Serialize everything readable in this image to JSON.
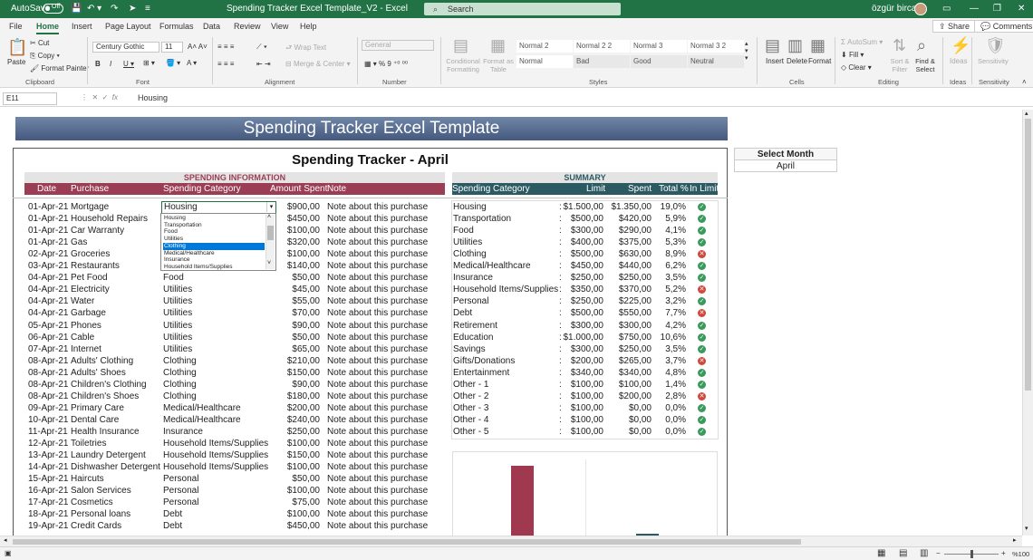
{
  "titlebar": {
    "autosave": "AutoSave",
    "autosave_state": "Off",
    "doc_title": "Spending Tracker Excel Template_V2  -  Excel",
    "search": "Search",
    "user": "özgür bircan"
  },
  "menu": {
    "tabs": [
      "File",
      "Home",
      "Insert",
      "Page Layout",
      "Formulas",
      "Data",
      "Review",
      "View",
      "Help"
    ],
    "share": "Share",
    "comments": "Comments"
  },
  "ribbon": {
    "clipboard": {
      "paste": "Paste",
      "cut": "Cut",
      "copy": "Copy",
      "format_painter": "Format Painter",
      "label": "Clipboard"
    },
    "font": {
      "name": "Century Gothic",
      "size": "11",
      "label": "Font"
    },
    "alignment": {
      "wrap": "Wrap Text",
      "merge": "Merge & Center",
      "label": "Alignment"
    },
    "number": {
      "format": "General",
      "label": "Number"
    },
    "styles": {
      "conditional": "Conditional Formatting",
      "format_table": "Format as Table",
      "cells": [
        "Normal 2",
        "Normal 2 2",
        "Normal 3",
        "Normal 3 2",
        "Normal",
        "Bad",
        "Good",
        "Neutral"
      ],
      "label": "Styles"
    },
    "cells": {
      "insert": "Insert",
      "delete": "Delete",
      "format": "Format",
      "label": "Cells"
    },
    "editing": {
      "autosum": "AutoSum",
      "fill": "Fill",
      "clear": "Clear",
      "sort": "Sort & Filter",
      "find": "Find & Select",
      "label": "Editing"
    },
    "ideas": {
      "label": "Ideas"
    },
    "sensitivity": {
      "label": "Sensitivity"
    }
  },
  "formula": {
    "cell_ref": "E11",
    "value": "Housing"
  },
  "sheet": {
    "banner": "Spending Tracker Excel Template",
    "title": "Spending Tracker - April",
    "spending_info": "SPENDING INFORMATION",
    "summary": "SUMMARY",
    "select_month_label": "Select Month",
    "select_month_value": "April",
    "headers": {
      "date": "Date",
      "purchase": "Purchase",
      "category": "Spending Category",
      "amount": "Amount Spent",
      "note": "Note"
    },
    "summary_headers": {
      "category": "Spending Category",
      "limit": "Limit",
      "spent": "Spent",
      "pct": "Total %",
      "inlimit": "In Limit"
    },
    "rows": [
      {
        "date": "01-Apr-21",
        "purchase": "Mortgage",
        "category": "Housing",
        "amount": "$900,00",
        "note": "Note about this purchase"
      },
      {
        "date": "01-Apr-21",
        "purchase": "Household Repairs",
        "category": "",
        "amount": "$450,00",
        "note": "Note about this purchase"
      },
      {
        "date": "01-Apr-21",
        "purchase": "Car Warranty",
        "category": "",
        "amount": "$100,00",
        "note": "Note about this purchase"
      },
      {
        "date": "01-Apr-21",
        "purchase": "Gas",
        "category": "",
        "amount": "$320,00",
        "note": "Note about this purchase"
      },
      {
        "date": "02-Apr-21",
        "purchase": "Groceries",
        "category": "",
        "amount": "$100,00",
        "note": "Note about this purchase"
      },
      {
        "date": "03-Apr-21",
        "purchase": "Restaurants",
        "category": "",
        "amount": "$140,00",
        "note": "Note about this purchase"
      },
      {
        "date": "04-Apr-21",
        "purchase": "Pet Food",
        "category": "Food",
        "amount": "$50,00",
        "note": "Note about this purchase"
      },
      {
        "date": "04-Apr-21",
        "purchase": "Electricity",
        "category": "Utilities",
        "amount": "$45,00",
        "note": "Note about this purchase"
      },
      {
        "date": "04-Apr-21",
        "purchase": "Water",
        "category": "Utilities",
        "amount": "$55,00",
        "note": "Note about this purchase"
      },
      {
        "date": "04-Apr-21",
        "purchase": "Garbage",
        "category": "Utilities",
        "amount": "$70,00",
        "note": "Note about this purchase"
      },
      {
        "date": "05-Apr-21",
        "purchase": "Phones",
        "category": "Utilities",
        "amount": "$90,00",
        "note": "Note about this purchase"
      },
      {
        "date": "06-Apr-21",
        "purchase": "Cable",
        "category": "Utilities",
        "amount": "$50,00",
        "note": "Note about this purchase"
      },
      {
        "date": "07-Apr-21",
        "purchase": "Internet",
        "category": "Utilities",
        "amount": "$65,00",
        "note": "Note about this purchase"
      },
      {
        "date": "08-Apr-21",
        "purchase": "Adults' Clothing",
        "category": "Clothing",
        "amount": "$210,00",
        "note": "Note about this purchase"
      },
      {
        "date": "08-Apr-21",
        "purchase": "Adults' Shoes",
        "category": "Clothing",
        "amount": "$150,00",
        "note": "Note about this purchase"
      },
      {
        "date": "08-Apr-21",
        "purchase": "Children's Clothing",
        "category": "Clothing",
        "amount": "$90,00",
        "note": "Note about this purchase"
      },
      {
        "date": "08-Apr-21",
        "purchase": "Children's Shoes",
        "category": "Clothing",
        "amount": "$180,00",
        "note": "Note about this purchase"
      },
      {
        "date": "09-Apr-21",
        "purchase": "Primary Care",
        "category": "Medical/Healthcare",
        "amount": "$200,00",
        "note": "Note about this purchase"
      },
      {
        "date": "10-Apr-21",
        "purchase": "Dental Care",
        "category": "Medical/Healthcare",
        "amount": "$240,00",
        "note": "Note about this purchase"
      },
      {
        "date": "11-Apr-21",
        "purchase": "Health Insurance",
        "category": "Insurance",
        "amount": "$250,00",
        "note": "Note about this purchase"
      },
      {
        "date": "12-Apr-21",
        "purchase": "Toiletries",
        "category": "Household Items/Supplies",
        "amount": "$100,00",
        "note": "Note about this purchase"
      },
      {
        "date": "13-Apr-21",
        "purchase": "Laundry Detergent",
        "category": "Household Items/Supplies",
        "amount": "$150,00",
        "note": "Note about this purchase"
      },
      {
        "date": "14-Apr-21",
        "purchase": "Dishwasher Detergent",
        "category": "Household Items/Supplies",
        "amount": "$100,00",
        "note": "Note about this purchase"
      },
      {
        "date": "15-Apr-21",
        "purchase": "Haircuts",
        "category": "Personal",
        "amount": "$50,00",
        "note": "Note about this purchase"
      },
      {
        "date": "16-Apr-21",
        "purchase": "Salon Services",
        "category": "Personal",
        "amount": "$100,00",
        "note": "Note about this purchase"
      },
      {
        "date": "17-Apr-21",
        "purchase": "Cosmetics",
        "category": "Personal",
        "amount": "$75,00",
        "note": "Note about this purchase"
      },
      {
        "date": "18-Apr-21",
        "purchase": "Personal loans",
        "category": "Debt",
        "amount": "$100,00",
        "note": "Note about this purchase"
      },
      {
        "date": "19-Apr-21",
        "purchase": "Credit Cards",
        "category": "Debt",
        "amount": "$450,00",
        "note": "Note about this purchase"
      }
    ],
    "dropdown": [
      "Housing",
      "Transportation",
      "Food",
      "Utilities",
      "Clothing",
      "Medical/Healthcare",
      "Insurance",
      "Household Items/Supplies"
    ],
    "dropdown_selected": 4,
    "summary_rows": [
      {
        "category": "Housing",
        "limit": "$1.500,00",
        "spent": "$1.350,00",
        "pct": "19,0%",
        "ok": true
      },
      {
        "category": "Transportation",
        "limit": "$500,00",
        "spent": "$420,00",
        "pct": "5,9%",
        "ok": true
      },
      {
        "category": "Food",
        "limit": "$300,00",
        "spent": "$290,00",
        "pct": "4,1%",
        "ok": true
      },
      {
        "category": "Utilities",
        "limit": "$400,00",
        "spent": "$375,00",
        "pct": "5,3%",
        "ok": true
      },
      {
        "category": "Clothing",
        "limit": "$500,00",
        "spent": "$630,00",
        "pct": "8,9%",
        "ok": false
      },
      {
        "category": "Medical/Healthcare",
        "limit": "$450,00",
        "spent": "$440,00",
        "pct": "6,2%",
        "ok": true
      },
      {
        "category": "Insurance",
        "limit": "$250,00",
        "spent": "$250,00",
        "pct": "3,5%",
        "ok": true
      },
      {
        "category": "Household Items/Supplies",
        "limit": "$350,00",
        "spent": "$370,00",
        "pct": "5,2%",
        "ok": false
      },
      {
        "category": "Personal",
        "limit": "$250,00",
        "spent": "$225,00",
        "pct": "3,2%",
        "ok": true
      },
      {
        "category": "Debt",
        "limit": "$500,00",
        "spent": "$550,00",
        "pct": "7,7%",
        "ok": false
      },
      {
        "category": "Retirement",
        "limit": "$300,00",
        "spent": "$300,00",
        "pct": "4,2%",
        "ok": true
      },
      {
        "category": "Education",
        "limit": "$1.000,00",
        "spent": "$750,00",
        "pct": "10,6%",
        "ok": true
      },
      {
        "category": "Savings",
        "limit": "$300,00",
        "spent": "$250,00",
        "pct": "3,5%",
        "ok": true
      },
      {
        "category": "Gifts/Donations",
        "limit": "$200,00",
        "spent": "$265,00",
        "pct": "3,7%",
        "ok": false
      },
      {
        "category": "Entertainment",
        "limit": "$340,00",
        "spent": "$340,00",
        "pct": "4,8%",
        "ok": true
      },
      {
        "category": "Other - 1",
        "limit": "$100,00",
        "spent": "$100,00",
        "pct": "1,4%",
        "ok": true
      },
      {
        "category": "Other - 2",
        "limit": "$100,00",
        "spent": "$200,00",
        "pct": "2,8%",
        "ok": false
      },
      {
        "category": "Other - 3",
        "limit": "$100,00",
        "spent": "$0,00",
        "pct": "0,0%",
        "ok": true
      },
      {
        "category": "Other - 4",
        "limit": "$100,00",
        "spent": "$0,00",
        "pct": "0,0%",
        "ok": true
      },
      {
        "category": "Other - 5",
        "limit": "$100,00",
        "spent": "$0,00",
        "pct": "0,0%",
        "ok": true
      }
    ]
  },
  "status": {
    "zoom": "%100"
  },
  "colors": {
    "excel_green": "#217346",
    "spending_header": "#9b3d55",
    "summary_header": "#2c5a63",
    "banner": "#56698d",
    "bar": "#a0394f",
    "bar2": "#2c5a63"
  },
  "chart_data": {
    "type": "bar",
    "series": [
      {
        "values": [
          1
        ]
      },
      {
        "values": [
          0.04
        ]
      }
    ]
  }
}
